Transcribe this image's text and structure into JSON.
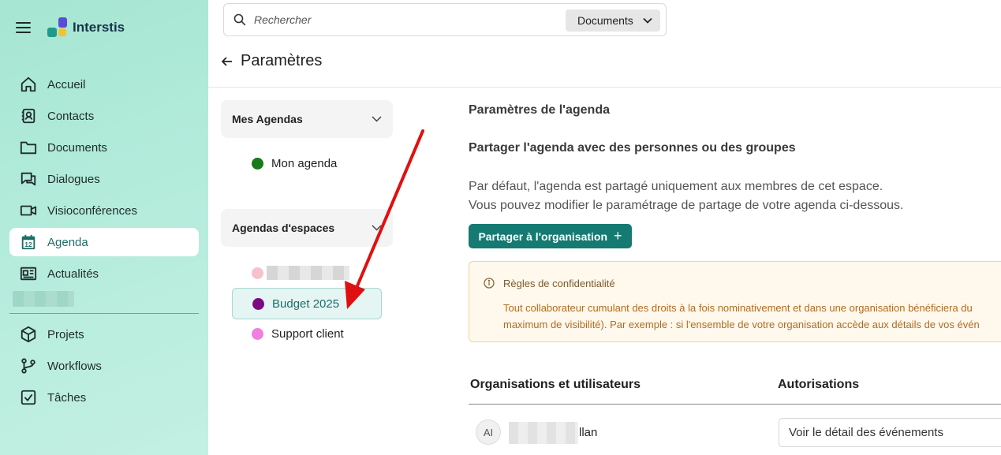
{
  "app": {
    "brand": "Interstis"
  },
  "sidebar": {
    "items": [
      {
        "label": "Accueil",
        "icon": "home-icon"
      },
      {
        "label": "Contacts",
        "icon": "contacts-icon"
      },
      {
        "label": "Documents",
        "icon": "folder-icon"
      },
      {
        "label": "Dialogues",
        "icon": "chat-icon"
      },
      {
        "label": "Visioconférences",
        "icon": "video-icon"
      },
      {
        "label": "Agenda",
        "icon": "calendar-icon",
        "active": true
      },
      {
        "label": "Actualités",
        "icon": "news-icon"
      }
    ],
    "secondary": [
      {
        "label": "Projets",
        "icon": "cube-icon"
      },
      {
        "label": "Workflows",
        "icon": "workflow-icon"
      },
      {
        "label": "Tâches",
        "icon": "checkbox-icon"
      }
    ],
    "calendar_icon_day": "12",
    "accent": "#1d6e67"
  },
  "search": {
    "placeholder": "Rechercher",
    "scope": "Documents"
  },
  "page": {
    "title": "Paramètres"
  },
  "calendars": {
    "mine_title": "Mes Agendas",
    "mine": [
      {
        "label": "Mon agenda",
        "color": "#1a7a1a"
      }
    ],
    "spaces_title": "Agendas d'espaces",
    "spaces": [
      {
        "label": "",
        "color": "#f5c2cc"
      },
      {
        "label": "Budget 2025",
        "color": "#7a0a82",
        "selected": true
      },
      {
        "label": "Support client",
        "color": "#f080e0"
      }
    ]
  },
  "settings": {
    "heading": "Paramètres de l'agenda",
    "share_heading": "Partager l'agenda avec des personnes ou des groupes",
    "desc_line1": "Par défaut, l'agenda est partagé uniquement aux membres de cet espace.",
    "desc_line2": "Vous pouvez modifier le paramétrage de partage de votre agenda ci-dessous.",
    "share_button": "Partager à l'organisation",
    "share_button_icon": "+",
    "alert": {
      "title": "Règles de confidentialité",
      "line1": "Tout collaborateur cumulant des droits à la fois nominativement et dans une organisation bénéficiera du",
      "line2": "maximum de visibilité). Par exemple : si l'ensemble de votre organisation accède aux détails de vos évén"
    },
    "table": {
      "col1": "Organisations et utilisateurs",
      "col2": "Autorisations",
      "rows": [
        {
          "initials": "AI",
          "name": "llan",
          "permission": "Voir le détail des événements"
        }
      ]
    },
    "button_color": "#147a72",
    "annotation_arrow_color": "#e01010"
  }
}
